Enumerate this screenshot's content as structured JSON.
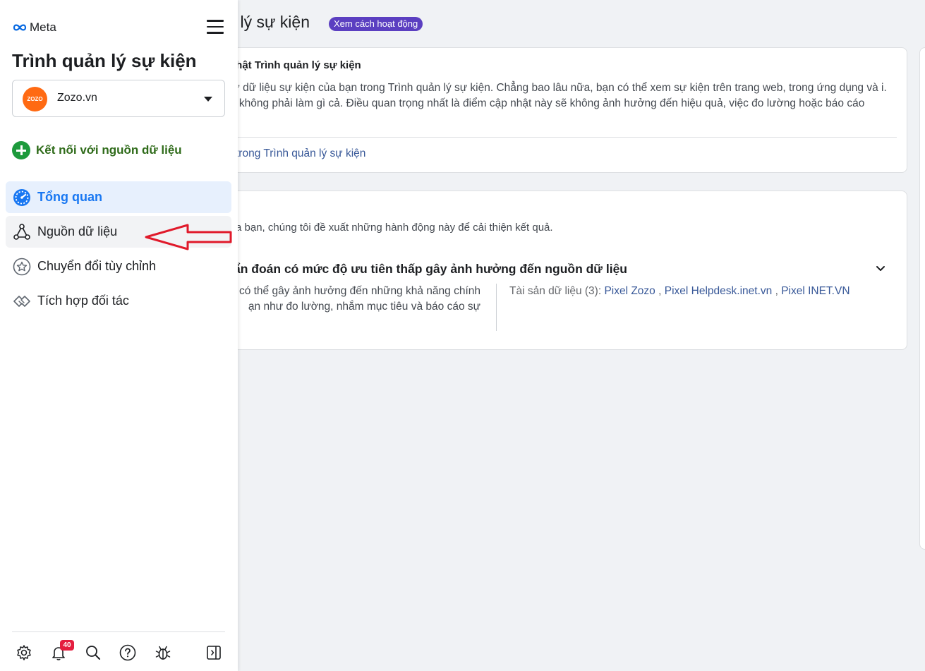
{
  "header": {
    "page_title": "lý sự kiện",
    "pill_label": "Xem cách hoạt động"
  },
  "update_card": {
    "title": "nhật Trình quản lý sự kiện",
    "body": "u trữ dữ liệu sự kiện của bạn trong Trình quản lý sự kiện. Chẳng bao lâu nữa, bạn có thể xem sự kiện trên trang web, trong ứng dụng và i. Bạn không phải làm gì cả. Điều quan trọng nhất là điểm cập nhật này sẽ không ảnh hưởng đến hiệu quả, việc đo lường hoặc báo cáo",
    "link": "trong Trình quản lý sự kiện"
  },
  "recommend_card": {
    "intro": "a bạn, chúng tôi đề xuất những hành động này để cải thiện kết quả.",
    "heading": "ẩn đoán có mức độ ưu tiên thấp gây ảnh hưởng đến nguồn dữ liệu",
    "description": "có thể gây ảnh hưởng đến những khả năng chính ạn như đo lường, nhắm mục tiêu và báo cáo sự",
    "assets_label": "Tài sản dữ liệu (3):",
    "assets": [
      "Pixel Zozo",
      "Pixel Helpdesk.inet.vn",
      "Pixel INET.VN"
    ],
    "separator": ","
  },
  "sidebar": {
    "brand": "Meta",
    "app_title": "Trình quản lý sự kiện",
    "account": {
      "name": "Zozo.vn",
      "avatar_text": "ZOZO"
    },
    "connect_label": "Kết nối với nguồn dữ liệu",
    "nav": [
      {
        "label": "Tổng quan",
        "icon": "dashboard-icon",
        "active": true
      },
      {
        "label": "Nguồn dữ liệu",
        "icon": "data-sources-icon",
        "active": false
      },
      {
        "label": "Chuyển đổi tùy chỉnh",
        "icon": "star-icon",
        "active": false
      },
      {
        "label": "Tích hợp đối tác",
        "icon": "handshake-icon",
        "active": false
      }
    ],
    "notification_count": "40",
    "bottom_icons": [
      "gear-icon",
      "bell-icon",
      "search-icon",
      "help-icon",
      "bug-icon",
      "panel-toggle-icon"
    ]
  },
  "colors": {
    "accent": "#1877f2",
    "pill": "#5b3fc1",
    "connect_green": "#1d9a3c",
    "annotation_arrow": "#e0192a",
    "badge": "#e41e3f"
  }
}
